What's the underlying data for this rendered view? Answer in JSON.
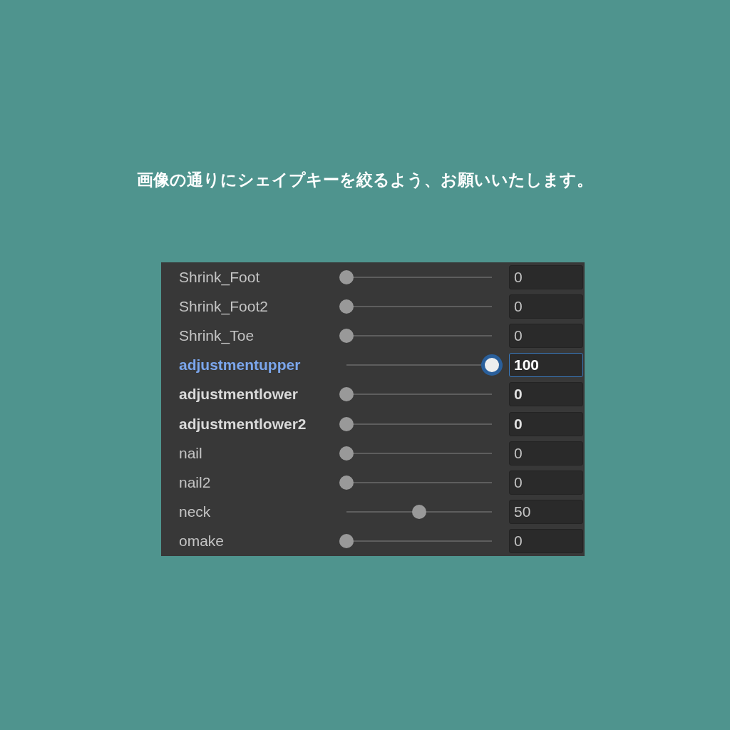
{
  "heading": "画像の通りにシェイプキーを絞るよう、お願いいたします。",
  "blendshapes": [
    {
      "name": "Shrink_Foot",
      "level": 0,
      "value": "0",
      "modified": false,
      "focused": false
    },
    {
      "name": "Shrink_Foot2",
      "level": 0,
      "value": "0",
      "modified": false,
      "focused": false
    },
    {
      "name": "Shrink_Toe",
      "level": 0,
      "value": "0",
      "modified": false,
      "focused": false
    },
    {
      "name": "adjustmentupper",
      "level": 1,
      "value": "100",
      "modified": true,
      "focused": true
    },
    {
      "name": "adjustmentlower",
      "level": 0,
      "value": "0",
      "modified": true,
      "focused": false
    },
    {
      "name": "adjustmentlower2",
      "level": 0,
      "value": "0",
      "modified": true,
      "focused": false
    },
    {
      "name": "nail",
      "level": 0,
      "value": "0",
      "modified": false,
      "focused": false
    },
    {
      "name": "nail2",
      "level": 0,
      "value": "0",
      "modified": false,
      "focused": false
    },
    {
      "name": "neck",
      "level": 0.5,
      "value": "50",
      "modified": false,
      "focused": false
    },
    {
      "name": "omake",
      "level": 0,
      "value": "0",
      "modified": false,
      "focused": false
    }
  ]
}
